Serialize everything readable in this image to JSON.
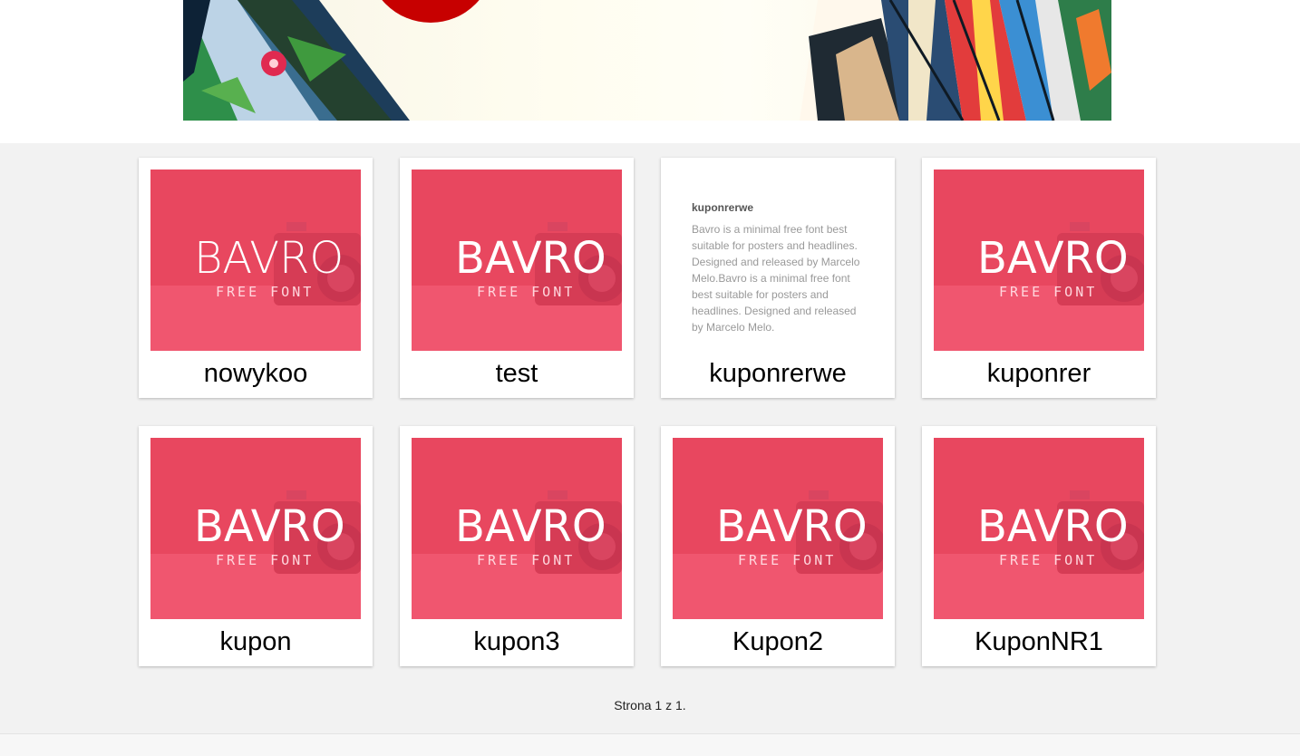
{
  "cards": [
    {
      "title": "nowykoo",
      "image": {
        "main": "BAVRO",
        "sub": "FREE FONT"
      }
    },
    {
      "title": "test",
      "image": {
        "main": "BAVRO",
        "sub": "FREE FONT"
      }
    },
    {
      "title": "kuponrerwe",
      "description": {
        "heading": "kuponrerwe",
        "text": "Bavro is a minimal free font best suitable for posters and headlines. Designed and released by Marcelo Melo.Bavro is a minimal free font best suitable for posters and headlines. Designed and released by Marcelo Melo."
      }
    },
    {
      "title": "kuponrer",
      "image": {
        "main": "BAVRO",
        "sub": "FREE FONT"
      }
    },
    {
      "title": "kupon",
      "image": {
        "main": "BAVRO",
        "sub": "FREE FONT"
      }
    },
    {
      "title": "kupon3",
      "image": {
        "main": "BAVRO",
        "sub": "FREE FONT"
      }
    },
    {
      "title": "Kupon2",
      "image": {
        "main": "BAVRO",
        "sub": "FREE FONT"
      }
    },
    {
      "title": "KuponNR1",
      "image": {
        "main": "BAVRO",
        "sub": "FREE FONT"
      }
    }
  ],
  "pagination": {
    "label": "Strona 1 z 1."
  },
  "colors": {
    "page_bg": "#f2f2f2",
    "card_bg": "#ffffff",
    "thumb_pink": "#e8475f",
    "banner_red": "#c70000"
  }
}
